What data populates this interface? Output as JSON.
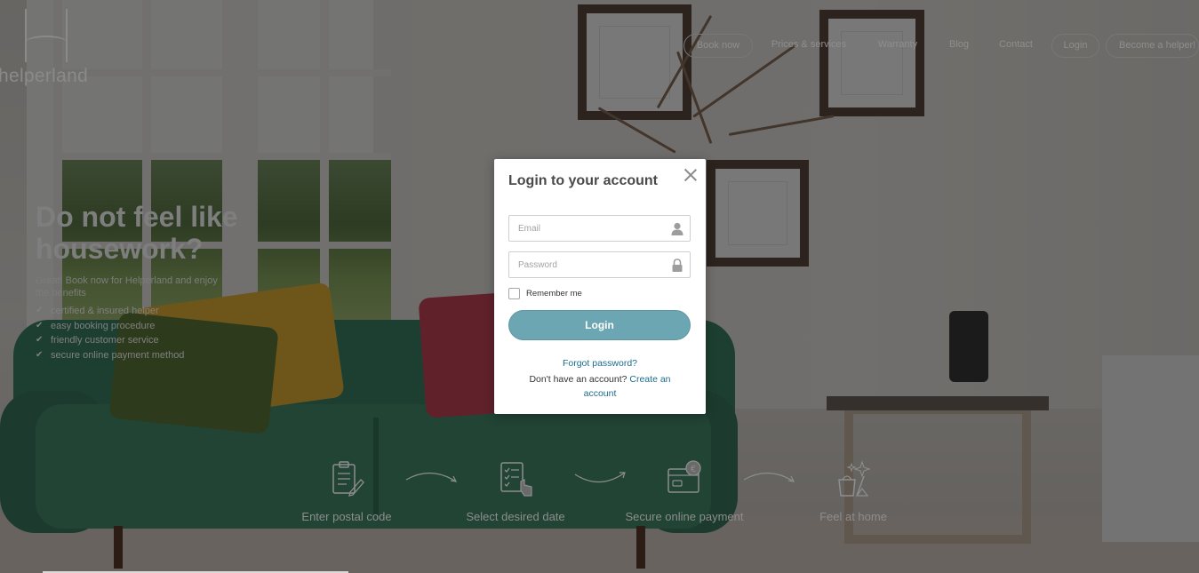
{
  "brand": {
    "logo_text": "helperland"
  },
  "nav": {
    "items": [
      {
        "label": "Book now",
        "outlined": true
      },
      {
        "label": "Prices & services",
        "outlined": false
      },
      {
        "label": "Warranty",
        "outlined": false
      },
      {
        "label": "Blog",
        "outlined": false
      },
      {
        "label": "Contact",
        "outlined": false
      },
      {
        "label": "Login",
        "outlined": true
      },
      {
        "label": "Become a helper!",
        "outlined": true
      }
    ]
  },
  "hero": {
    "title": "Do not feel like housework?",
    "subtitle": "Great! Book now for Helperland and enjoy the benefits",
    "benefits": [
      "certified & insured helper",
      "easy booking procedure",
      "friendly customer service",
      "secure online payment method"
    ]
  },
  "steps": [
    {
      "label": "Enter postal code",
      "icon": "clipboard-pen-icon"
    },
    {
      "label": "Select desired date",
      "icon": "checklist-hand-icon"
    },
    {
      "label": "Secure online payment",
      "icon": "card-payment-icon"
    },
    {
      "label": "Feel at home",
      "icon": "cleaning-sparkle-icon"
    }
  ],
  "modal": {
    "title": "Login to your account",
    "email_placeholder": "Email",
    "password_placeholder": "Password",
    "remember_label": "Remember me",
    "login_button": "Login",
    "forgot_password": "Forgot password?",
    "no_account_text": "Don't have an account?",
    "create_account": "Create an account"
  },
  "colors": {
    "accent": "#6ba6b2",
    "link": "#1d6b8c",
    "overlay": "rgba(0,0,0,0.52)"
  }
}
